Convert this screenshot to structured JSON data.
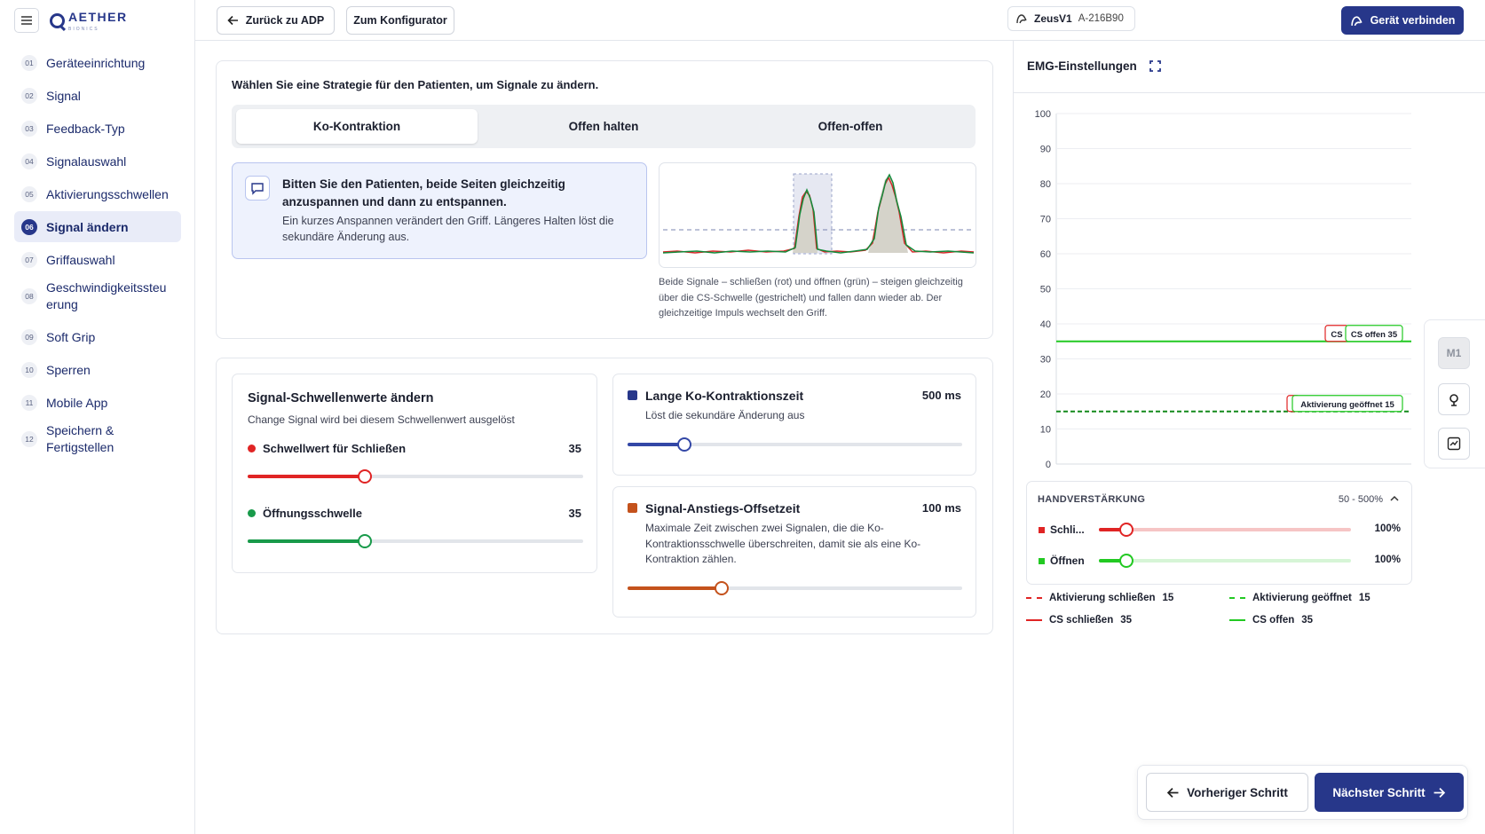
{
  "brand": {
    "name": "AETHER",
    "sub": "BIONICS"
  },
  "nav": [
    {
      "num": "01",
      "label": "Geräteeinrichtung"
    },
    {
      "num": "02",
      "label": "Signal"
    },
    {
      "num": "03",
      "label": "Feedback-Typ"
    },
    {
      "num": "04",
      "label": "Signalauswahl"
    },
    {
      "num": "05",
      "label": "Aktivierungsschwellen"
    },
    {
      "num": "06",
      "label": "Signal ändern",
      "active": true
    },
    {
      "num": "07",
      "label": "Griffauswahl"
    },
    {
      "num": "08",
      "label": "Geschwindigkeitssteuerung",
      "line1": "Geschwindigkeitssteu",
      "line2": "erung"
    },
    {
      "num": "09",
      "label": "Soft Grip"
    },
    {
      "num": "10",
      "label": "Sperren"
    },
    {
      "num": "11",
      "label": "Mobile App"
    },
    {
      "num": "12",
      "label": "Speichern & Fertigstellen",
      "line1": "Speichern &",
      "line2": "Fertigstellen"
    }
  ],
  "topbar": {
    "back_label": "Zurück zu ADP",
    "configurator_label": "Zum Konfigurator",
    "device_name": "ZeusV1",
    "device_serial": "A-216B90",
    "connect_label": "Gerät verbinden"
  },
  "strategy": {
    "heading": "Wählen Sie eine Strategie für den Patienten, um Signale zu ändern.",
    "tabs": [
      "Ko-Kontraktion",
      "Offen halten",
      "Offen-offen"
    ],
    "selected_tab": 0,
    "info_title": "Bitten Sie den Patienten, beide Seiten gleichzeitig anzuspannen und dann zu entspannen.",
    "info_desc": "Ein kurzes Anspannen verändert den Griff. Längeres Halten löst die sekundäre Änderung aus.",
    "caption": "Beide Signale – schließen (rot) und öffnen (grün) – steigen gleichzeitig über die CS-Schwelle (gestrichelt) und fallen dann wieder ab. Der gleichzeitige Impuls wechselt den Griff."
  },
  "thresholds": {
    "title": "Signal-Schwellenwerte ändern",
    "desc": "Change Signal wird bei diesem Schwellenwert ausgelöst",
    "close_label": "Schwellwert für Schließen",
    "close_value": "35",
    "close_fraction": 0.35,
    "open_label": "Öffnungsschwelle",
    "open_value": "35",
    "open_fraction": 0.35
  },
  "cocontraction": {
    "title": "Lange Ko-Kontraktionszeit",
    "value": "500 ms",
    "desc": "Löst die sekundäre Änderung aus",
    "fraction": 0.17
  },
  "offset": {
    "title": "Signal-Anstiegs-Offsetzeit",
    "value": "100 ms",
    "desc": "Maximale Zeit zwischen zwei Signalen, die die Ko-Kontraktionsschwelle überschreiten, damit sie als eine Ko-Kontraktion zählen.",
    "fraction": 0.28
  },
  "emg": {
    "title": "EMG-Einstellungen",
    "rail_m1": "M1",
    "gain_title": "HANDVERSTÄRKUNG",
    "gain_range": "50 - 500%",
    "gain_close_label": "Schli...",
    "gain_close_value": "100%",
    "gain_open_label": "Öffnen",
    "gain_open_value": "100%",
    "gain_fraction": 0.11,
    "legend": [
      {
        "label": "Aktivierung schließen",
        "value": "15",
        "color": "#e02424",
        "dashed": true
      },
      {
        "label": "Aktivierung geöffnet",
        "value": "15",
        "color": "#22c922",
        "dashed": true
      },
      {
        "label": "CS schließen",
        "value": "35",
        "color": "#e02424",
        "dashed": false
      },
      {
        "label": "CS offen",
        "value": "35",
        "color": "#22c922",
        "dashed": false
      }
    ]
  },
  "chart_data": {
    "type": "line",
    "ylim": [
      0,
      100
    ],
    "yticks": [
      "100",
      "90",
      "80",
      "70",
      "60",
      "50",
      "40",
      "30",
      "20",
      "10",
      "0"
    ],
    "series": [
      {
        "name": "CS schließen",
        "values": [
          35
        ],
        "color": "#e02424",
        "style": "solid"
      },
      {
        "name": "CS offen",
        "values": [
          35
        ],
        "color": "#22c922",
        "style": "solid"
      },
      {
        "name": "Aktivierung schließen",
        "values": [
          15
        ],
        "color": "#e02424",
        "style": "dashed"
      },
      {
        "name": "Aktivierung geöffnet",
        "values": [
          15
        ],
        "color": "#138a1b",
        "style": "dashed"
      }
    ],
    "line_labels": {
      "cs_close": "CS",
      "cs_open": "CS offen 35",
      "act_open": "Aktivierung geöffnet 15"
    }
  },
  "footer": {
    "prev_label": "Vorheriger Schritt",
    "next_label": "Nächster Schritt"
  },
  "colors": {
    "accent": "#27378a",
    "close": "#e02424",
    "open": "#189a4a",
    "blue": "#3347a6",
    "orange": "#c4521c"
  }
}
